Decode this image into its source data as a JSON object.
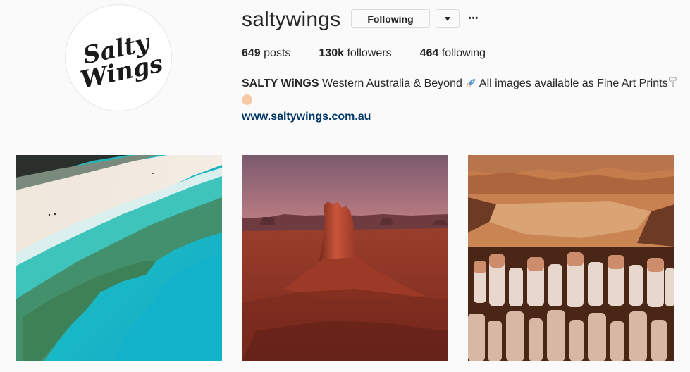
{
  "profile": {
    "username": "saltywings",
    "avatar_text_line1": "Salty",
    "avatar_text_line2": "Wings",
    "following_label": "Following",
    "dropdown_icon": "triangle-down-icon",
    "more_icon": "ellipsis-icon",
    "more_label": "•••"
  },
  "stats": {
    "posts_count": "649",
    "posts_label": "posts",
    "followers_count": "130k",
    "followers_label": "followers",
    "following_count": "464",
    "following_label": "following"
  },
  "bio": {
    "name": "SALTY WiNGS",
    "text_part1": "Western Australia & Beyond",
    "rocket_icon": "rocket-icon",
    "text_part2": "All images available as Fine Art Prints",
    "finger_icon": "pointing-down-icon",
    "website": "www.saltywings.com.au"
  },
  "posts": [
    {
      "name": "beach-aerial-photo"
    },
    {
      "name": "desert-butte-photo"
    },
    {
      "name": "canyon-hoodoos-photo"
    }
  ]
}
